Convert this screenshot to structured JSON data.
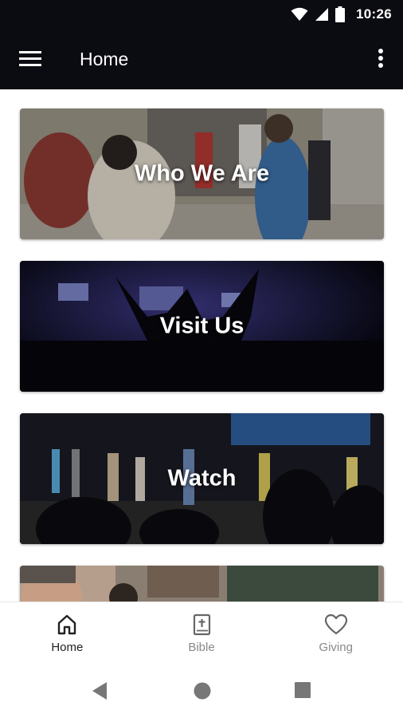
{
  "status_bar": {
    "time": "10:26"
  },
  "app_bar": {
    "title": "Home"
  },
  "cards": [
    {
      "label": "Who We Are"
    },
    {
      "label": "Visit Us"
    },
    {
      "label": "Watch"
    },
    {
      "label": ""
    }
  ],
  "bottom_nav": [
    {
      "label": "Home",
      "icon": "home-icon",
      "active": true
    },
    {
      "label": "Bible",
      "icon": "bible-icon",
      "active": false
    },
    {
      "label": "Giving",
      "icon": "heart-icon",
      "active": false
    }
  ],
  "colors": {
    "app_bar": "#0b0b12",
    "active": "#222222",
    "inactive": "#888888"
  }
}
